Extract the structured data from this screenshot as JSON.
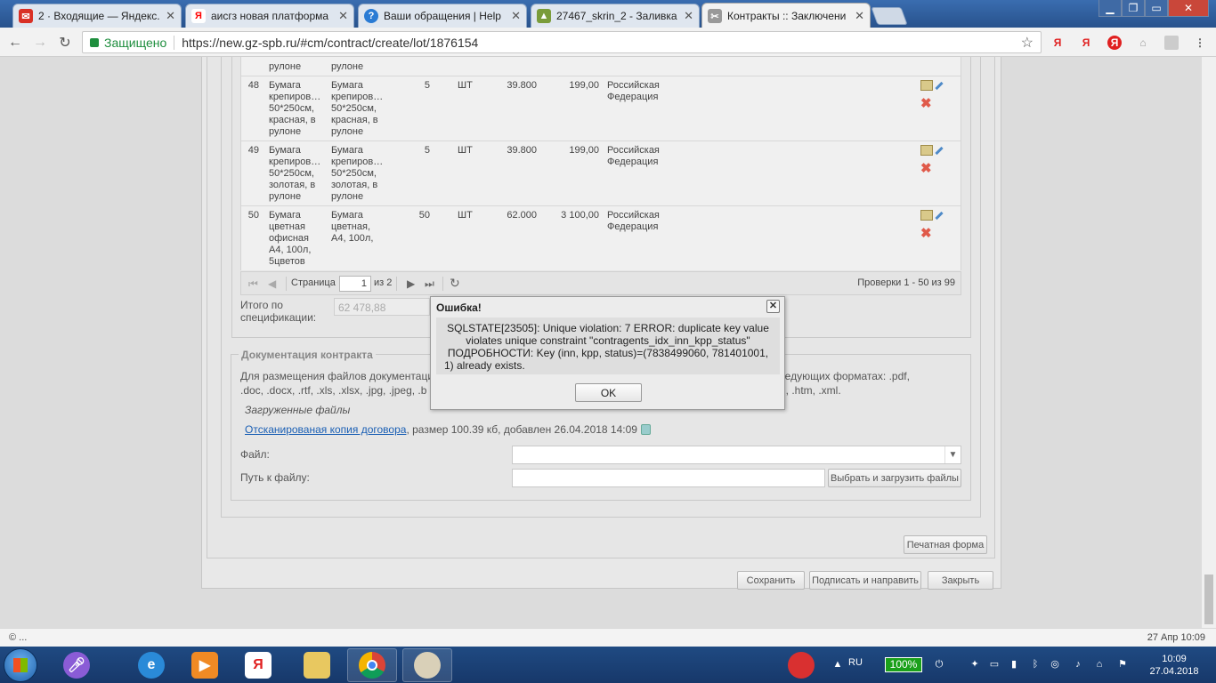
{
  "browser": {
    "tabs": [
      {
        "icon": "gmail-icon",
        "title": "2 · Входящие — Яндекс.",
        "color": "#d93025"
      },
      {
        "icon": "yandex-icon",
        "title": "аисгз новая платформа",
        "color": "#ff0000"
      },
      {
        "icon": "help-icon",
        "title": "Ваши обращения | Help",
        "color": "#2a7bd4"
      },
      {
        "icon": "image-icon",
        "title": "27467_skrin_2 - Заливка",
        "color": "#7a9c3a"
      },
      {
        "icon": "tools-icon",
        "title": "Контракты :: Заключени",
        "color": "#777777"
      }
    ],
    "secure_label": "Защищено",
    "url": "https://new.gz-spb.ru/#cm/contract/create/lot/1876154",
    "extension_labels": [
      "Я",
      "Я",
      "Я"
    ]
  },
  "grid": {
    "rows_top_partial": {
      "name": "рулоне",
      "name2": "рулоне"
    },
    "rows": [
      {
        "num": "48",
        "name": "Бумага крепиров… 50*250см, красная, в рулоне",
        "name2": "Бумага крепиров… 50*250см, красная, в рулоне",
        "qty": "5",
        "unit": "ШТ",
        "price": "39.800",
        "sum": "199,00",
        "country": "Российская Федерация"
      },
      {
        "num": "49",
        "name": "Бумага крепиров… 50*250см, золотая, в рулоне",
        "name2": "Бумага крепиров… 50*250см, золотая, в рулоне",
        "qty": "5",
        "unit": "ШТ",
        "price": "39.800",
        "sum": "199,00",
        "country": "Российская Федерация"
      },
      {
        "num": "50",
        "name": "Бумага цветная офисная А4, 100л, 5цветов",
        "name2": "Бумага цветная, А4, 100л,",
        "qty": "50",
        "unit": "ШТ",
        "price": "62.000",
        "sum": "3 100,00",
        "country": "Российская Федерация"
      }
    ],
    "pager": {
      "page_label": "Страница",
      "page_value": "1",
      "of_label": "из 2",
      "summary": "Проверки 1 - 50 из 99"
    }
  },
  "totals": {
    "label": "Итого по спецификации:",
    "value": "62 478,88"
  },
  "docs": {
    "legend": "Документация контракта",
    "text_left": "Для размещения файлов документаци",
    "text_left2": ".doc, .docx, .rtf, .xls, .xlsx, .jpg, .jpeg, .b",
    "text_right": "лы в следующих форматах: .pdf,",
    "text_right2": "ml, .htm, .xml.",
    "loaded_label": "Загруженные файлы",
    "file_link": "Отсканированая копия договора",
    "file_meta": ", размер 100.39 кб, добавлен 26.04.2018 14:09",
    "file_label": "Файл:",
    "path_label": "Путь к файлу:",
    "upload_button": "Выбрать и загрузить файлы"
  },
  "actions": {
    "print": "Печатная форма",
    "save": "Сохранить",
    "sign": "Подписать и направить",
    "close": "Закрыть"
  },
  "dialog": {
    "title": "Ошибка!",
    "close": "✕",
    "line1": "SQLSTATE[23505]: Unique violation: 7 ERROR: duplicate key value",
    "line2": "violates unique constraint \"contragents_idx_inn_kpp_status\"",
    "line3": "ПОДРОБНОСТИ: Key (inn, kpp, status)=(7838499060, 781401001,",
    "line4": "1) already exists.",
    "ok": "OK"
  },
  "statusbar": {
    "left": "© ...",
    "right": "27 Апр 10:09"
  },
  "taskbar": {
    "lang": "RU",
    "battery": "100%",
    "time": "10:09",
    "date": "27.04.2018"
  }
}
